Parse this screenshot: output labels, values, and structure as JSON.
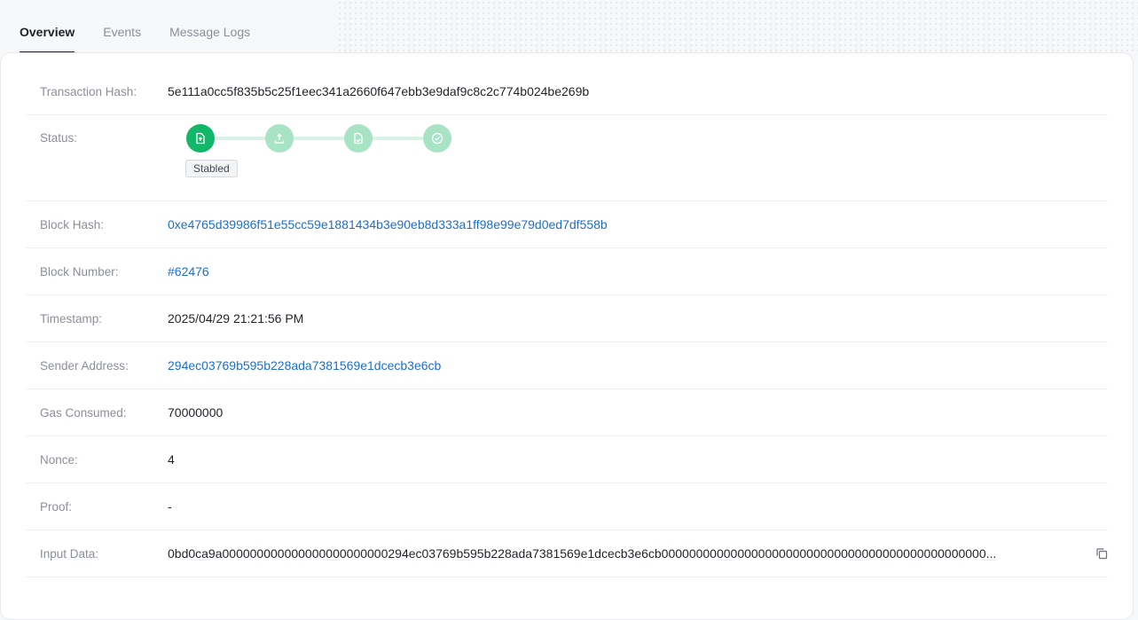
{
  "tabs": [
    {
      "label": "Overview",
      "active": true
    },
    {
      "label": "Events",
      "active": false
    },
    {
      "label": "Message Logs",
      "active": false
    }
  ],
  "fields": {
    "tx_hash": {
      "label": "Transaction Hash",
      "value": "5e111a0cc5f835b5c25f1eec341a2660f647ebb3e9daf9c8c2c774b024be269b"
    },
    "status": {
      "label": "Status",
      "badge": "Stabled",
      "steps": [
        "file-upload-icon",
        "upload-icon",
        "document-icon",
        "check-circle-icon"
      ],
      "active_step": 0
    },
    "block_hash": {
      "label": "Block Hash",
      "value": "0xe4765d39986f51e55cc59e1881434b3e90eb8d333a1ff98e99e79d0ed7df558b"
    },
    "block_number": {
      "label": "Block Number",
      "value": "#62476"
    },
    "timestamp": {
      "label": "Timestamp",
      "value": "2025/04/29 21:21:56 PM"
    },
    "sender": {
      "label": "Sender Address",
      "value": "294ec03769b595b228ada7381569e1dcecb3e6cb"
    },
    "gas": {
      "label": "Gas Consumed",
      "value": "70000000"
    },
    "nonce": {
      "label": "Nonce",
      "value": "4"
    },
    "proof": {
      "label": "Proof",
      "value": "-"
    },
    "input": {
      "label": "Input Data",
      "value": "0bd0ca9a000000000000000000000000294ec03769b595b228ada7381569e1dcecb3e6cb00000000000000000000000000000000000000000000000..."
    }
  },
  "colors": {
    "link": "#1a6fd1",
    "step_active": "#12b76a",
    "step_inactive": "#a8e3c6"
  }
}
